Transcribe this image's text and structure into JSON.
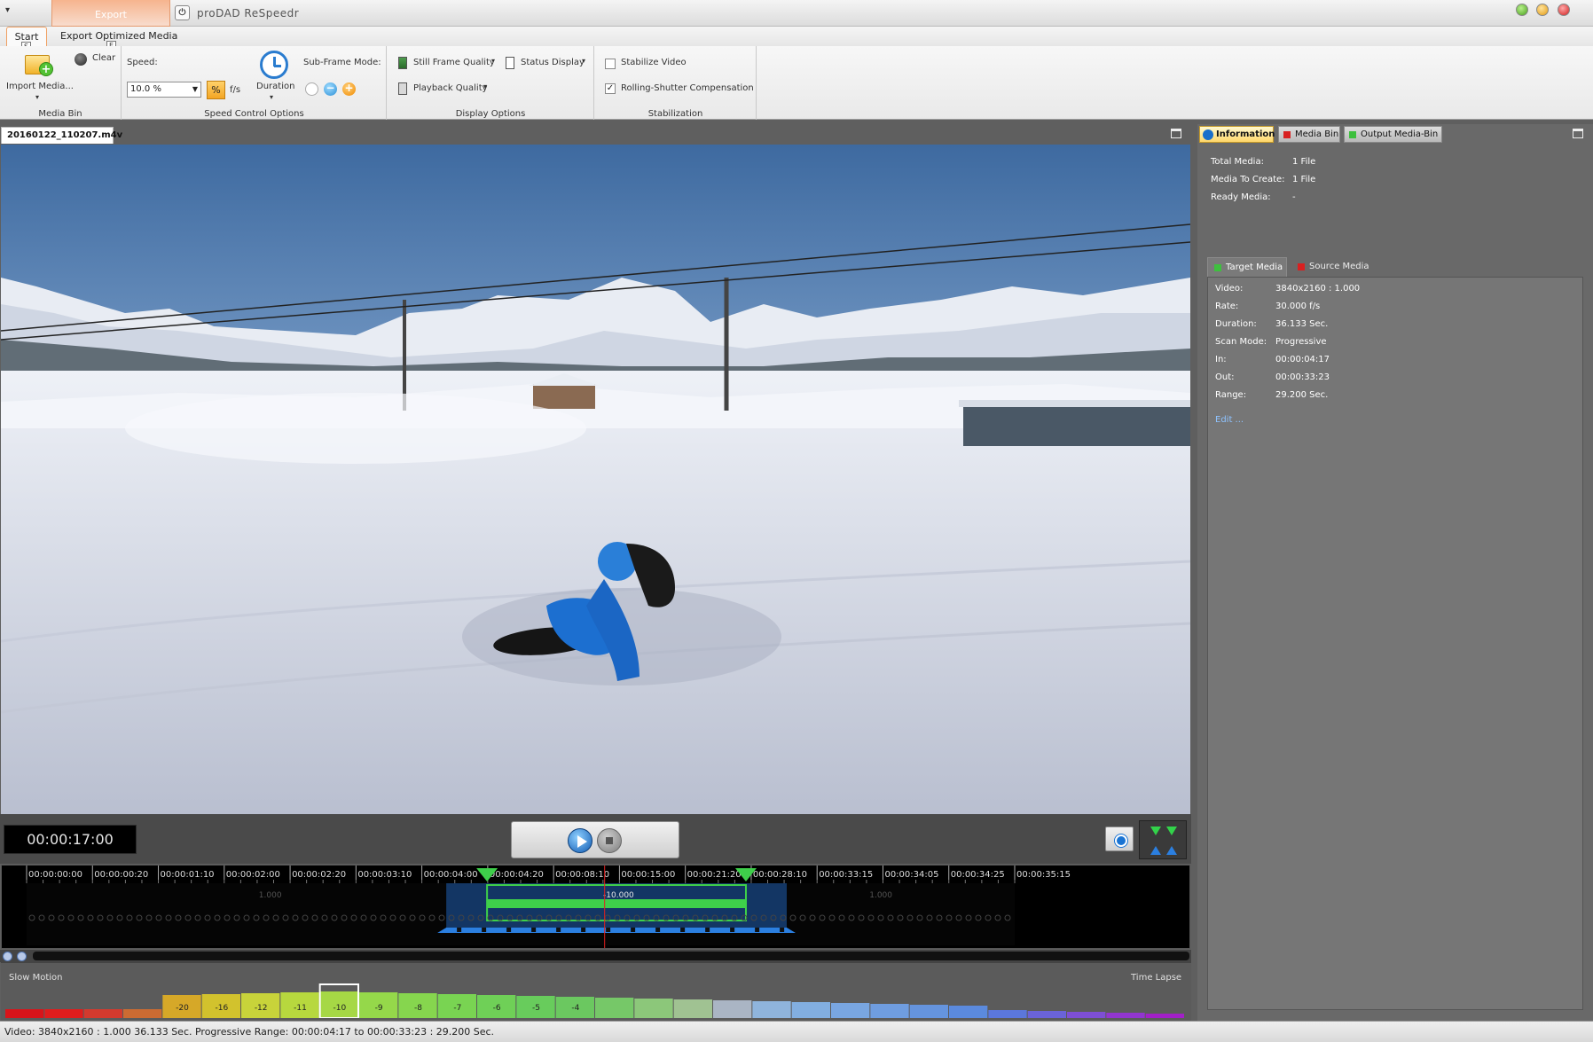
{
  "titlebar": {
    "app_title": "proDAD ReSpeedr",
    "context_tab": "Export",
    "logo_glyph": "⏻"
  },
  "ribbon": {
    "tabs": [
      "Start",
      "Export Optimized Media"
    ],
    "keytips": [
      "S",
      "E"
    ],
    "groups": {
      "media_bin": {
        "label": "Media Bin",
        "import_label": "Import Media...",
        "clear_label": "Clear"
      },
      "speed": {
        "label": "Speed Control Options",
        "speed_label": "Speed:",
        "speed_value": "10.0 %",
        "pct_symbol": "%",
        "fps_label": "f/s",
        "duration_label": "Duration",
        "subframe_label": "Sub-Frame Mode:"
      },
      "display": {
        "label": "Display Options",
        "still_quality": "Still Frame Quality",
        "status_display": "Status Display",
        "playback_quality": "Playback Quality"
      },
      "stabilization": {
        "label": "Stabilization",
        "stabilize_video": "Stabilize Video",
        "stabilize_checked": false,
        "rolling_shutter": "Rolling-Shutter Compensation",
        "rolling_checked": true
      }
    }
  },
  "viewer": {
    "file_tab": "20160122_110207.m4v",
    "timecode": "00:00:17:00"
  },
  "timeline": {
    "ticks": [
      "00:00:00:00",
      "00:00:00:20",
      "00:00:01:10",
      "00:00:02:00",
      "00:00:02:20",
      "00:00:03:10",
      "00:00:04:00",
      "00:00:04:20",
      "00:00:08:10",
      "00:00:15:00",
      "00:00:21:20",
      "00:00:28:10",
      "00:00:33:15",
      "00:00:34:05",
      "00:00:34:25",
      "00:00:35:15"
    ],
    "left_speed": "1.000",
    "mid_speed": "-10.000",
    "right_speed": "1.000",
    "in_fraction": 0.466,
    "out_fraction": 0.728,
    "playhead_fraction": 0.585
  },
  "speed_scale": {
    "slow_label": "Slow Motion",
    "fast_label": "Time Lapse",
    "labels": [
      "-20",
      "-16",
      "-12",
      "-11",
      "-10",
      "-9",
      "-8",
      "-7",
      "-6",
      "-5",
      "-4"
    ],
    "selected": "-10"
  },
  "info_panel": {
    "tabs": [
      "Information",
      "Media Bin",
      "Output Media-Bin"
    ],
    "rows": [
      {
        "key": "Total Media:",
        "value": "1 File"
      },
      {
        "key": "Media To Create:",
        "value": "1 File"
      },
      {
        "key": "Ready Media:",
        "value": "-"
      }
    ],
    "subtabs": [
      "Target Media",
      "Source Media"
    ],
    "target": [
      {
        "key": "Video:",
        "value": "3840x2160 : 1.000"
      },
      {
        "key": "Rate:",
        "value": "30.000 f/s"
      },
      {
        "key": "Duration:",
        "value": "36.133 Sec."
      },
      {
        "key": "Scan Mode:",
        "value": "Progressive"
      },
      {
        "key": "In:",
        "value": "00:00:04:17"
      },
      {
        "key": "Out:",
        "value": "00:00:33:23"
      },
      {
        "key": "Range:",
        "value": "29.200 Sec."
      }
    ],
    "edit_link": "Edit ..."
  },
  "statusbar": {
    "text": "Video: 3840x2160 : 1.000   36.133 Sec.   Progressive   Range: 00:00:04:17 to 00:00:33:23 : 29.200 Sec."
  },
  "colors": {
    "accent_orange": "#f3a523",
    "timeline_green": "#3ecf4a",
    "timeline_blue": "#1f5fb3",
    "playhead_red": "#e02020"
  },
  "icons": [
    "import-media-icon",
    "clear-icon",
    "duration-clock-icon",
    "subframe-off-icon",
    "subframe-minus-icon",
    "subframe-plus-icon",
    "help-icon",
    "info-icon",
    "play-icon",
    "stop-icon",
    "record-icon",
    "in-out-markers-icon",
    "zoom-in-icon",
    "zoom-out-icon"
  ]
}
